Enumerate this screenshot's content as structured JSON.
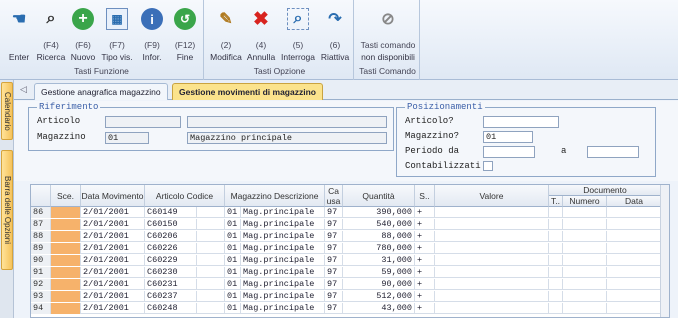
{
  "ribbon": {
    "funzioni": {
      "title": "Tasti Funzione",
      "buttons": [
        {
          "key": "",
          "label": "Enter",
          "icon": "hand-wave-icon"
        },
        {
          "key": "(F4)",
          "label": "Ricerca",
          "icon": "binoculars-icon"
        },
        {
          "key": "(F6)",
          "label": "Nuovo",
          "icon": "plus-icon"
        },
        {
          "key": "(F7)",
          "label": "Tipo vis.",
          "icon": "grid-view-icon"
        },
        {
          "key": "(F9)",
          "label": "Infor.",
          "icon": "info-icon"
        },
        {
          "key": "(F12)",
          "label": "Fine",
          "icon": "exit-icon"
        }
      ]
    },
    "opzioni": {
      "title": "Tasti Opzione",
      "buttons": [
        {
          "key": "(2)",
          "label": "Modifica",
          "icon": "edit-icon"
        },
        {
          "key": "(4)",
          "label": "Annulla",
          "icon": "delete-icon"
        },
        {
          "key": "(5)",
          "label": "Interroga",
          "icon": "query-icon"
        },
        {
          "key": "(6)",
          "label": "Riattiva",
          "icon": "reactivate-icon"
        }
      ]
    },
    "comando": {
      "title": "Tasti Comando",
      "line1": "Tasti comando",
      "line2": "non disponibili",
      "icon": "no-command-icon"
    }
  },
  "sidebar": {
    "tab1": "Calendario",
    "tab2": "Barra delle Opzioni"
  },
  "tabs": [
    {
      "label": "Gestione anagrafica magazzino",
      "active": false
    },
    {
      "label": "Gestione movimenti di magazzino",
      "active": true
    }
  ],
  "riferimento": {
    "legend": "Riferimento",
    "articolo_label": "Articolo",
    "articolo_value": "",
    "articolo_desc": "",
    "magazzino_label": "Magazzino",
    "magazzino_value": "01",
    "magazzino_desc": "Magazzino principale"
  },
  "posizionamenti": {
    "legend": "Posizionamenti",
    "articolo_label": "Articolo?",
    "articolo_value": "",
    "magazzino_label": "Magazzino?",
    "magazzino_value": "01",
    "periodo_label": "Periodo da",
    "periodo_from": "",
    "a_label": "a",
    "periodo_to": "",
    "contab_label": "Contabilizzati"
  },
  "grid": {
    "headers": {
      "sce": "Sce.",
      "data": "Data Movimento",
      "articolo": "Articolo Codice",
      "magazzino": "Magazzino Descrizione",
      "causa": "Ca usa",
      "quantita": "Quantità",
      "s": "S..",
      "valore": "Valore",
      "documento": "Documento",
      "t": "T..",
      "numero": "Numero",
      "doc_data": "Data"
    },
    "rows": [
      {
        "n": "86",
        "data": "2/01/2001",
        "art": "C60149",
        "mag": "01",
        "magdesc": "Mag.principale",
        "ca": "97",
        "qty": "390,000",
        "s": "+"
      },
      {
        "n": "87",
        "data": "2/01/2001",
        "art": "C60150",
        "mag": "01",
        "magdesc": "Mag.principale",
        "ca": "97",
        "qty": "540,000",
        "s": "+"
      },
      {
        "n": "88",
        "data": "2/01/2001",
        "art": "C60206",
        "mag": "01",
        "magdesc": "Mag.principale",
        "ca": "97",
        "qty": "88,000",
        "s": "+"
      },
      {
        "n": "89",
        "data": "2/01/2001",
        "art": "C60226",
        "mag": "01",
        "magdesc": "Mag.principale",
        "ca": "97",
        "qty": "780,000",
        "s": "+"
      },
      {
        "n": "90",
        "data": "2/01/2001",
        "art": "C60229",
        "mag": "01",
        "magdesc": "Mag.principale",
        "ca": "97",
        "qty": "31,000",
        "s": "+"
      },
      {
        "n": "91",
        "data": "2/01/2001",
        "art": "C60230",
        "mag": "01",
        "magdesc": "Mag.principale",
        "ca": "97",
        "qty": "59,000",
        "s": "+"
      },
      {
        "n": "92",
        "data": "2/01/2001",
        "art": "C60231",
        "mag": "01",
        "magdesc": "Mag.principale",
        "ca": "97",
        "qty": "90,000",
        "s": "+"
      },
      {
        "n": "93",
        "data": "2/01/2001",
        "art": "C60237",
        "mag": "01",
        "magdesc": "Mag.principale",
        "ca": "97",
        "qty": "512,000",
        "s": "+"
      },
      {
        "n": "94",
        "data": "2/01/2001",
        "art": "C60248",
        "mag": "01",
        "magdesc": "Mag.principale",
        "ca": "97",
        "qty": "43,000",
        "s": "+"
      }
    ]
  }
}
